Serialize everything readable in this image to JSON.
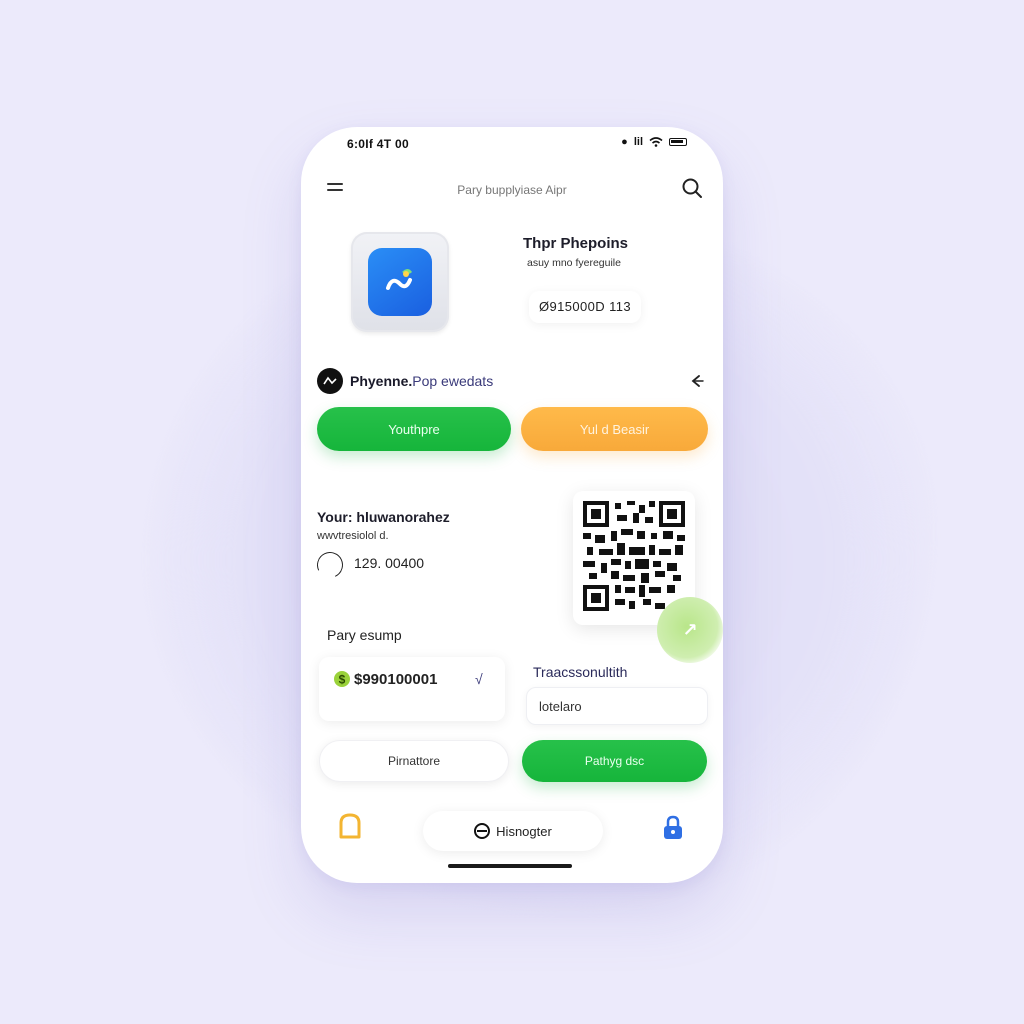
{
  "status_bar": {
    "time": "6:0If 4T 00",
    "signal_text": "lil"
  },
  "header": {
    "title": "Pary bupplyiase Aipr"
  },
  "app_card": {
    "name": "Thpr Phepoins",
    "subtitle": "asuy mno fyereguile",
    "balance": "Ø915000D  113"
  },
  "pay_row": {
    "label_strong": "Phyenne.",
    "label_light": "Pop ewedats"
  },
  "actions": {
    "primary_label": "Youthpre",
    "secondary_label": "Yul d Beasir"
  },
  "wallet": {
    "title": "Your: hluwanorahez",
    "subtitle": "wwvtresiolol d.",
    "amount": "129. 00400"
  },
  "payment": {
    "section_label": "Pary esump",
    "amount": "$990100001",
    "amount_suffix": "√",
    "transaction_label": "Traacssonultith",
    "transaction_value": "lotelaro"
  },
  "footer_buttons": {
    "secondary_label": "Pirnattore",
    "primary_label": "Pathyg dsc"
  },
  "bottom_nav": {
    "center_label": "Hisnogter"
  },
  "colors": {
    "accent_green": "#1bb83f",
    "accent_orange": "#fbae40",
    "app_icon_blue": "#1f74ec",
    "lock_blue": "#2f6fe4",
    "nav_left_yellow": "#f3b532"
  },
  "icons": {
    "menu": "hamburger-icon",
    "search": "search-icon",
    "share": "share-icon",
    "nav_left": "bookmark-icon",
    "nav_right": "lock-icon"
  }
}
